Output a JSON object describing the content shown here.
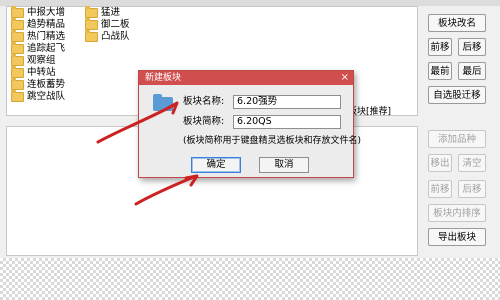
{
  "block_list": {
    "col1": [
      "中报大增",
      "趋势精品",
      "热门精选",
      "追踪起飞",
      "观察组",
      "中转站",
      "连板蓄势",
      "跳空战队"
    ],
    "col2": [
      "猛进",
      "御二板",
      "凸战队"
    ]
  },
  "save_header": "缓存板块[推荐]",
  "right_buttons": {
    "rename": "板块改名",
    "move_front": "前移",
    "move_back": "后移",
    "first": "最前",
    "last": "最后",
    "auto_move": "自选股迁移",
    "add_stock": "添加品种",
    "remove": "移出",
    "clear": "清空",
    "move_front2": "前移",
    "move_back2": "后移",
    "sort_in_block": "板块内排序",
    "export": "导出板块"
  },
  "dialog": {
    "title": "新建板块",
    "close": "×",
    "name_label": "板块名称:",
    "name_value": "6.20强势",
    "short_label": "板块简称:",
    "short_value": "6.20QS",
    "hint": "(板块简称用于键盘精灵选板块和存放文件名)",
    "ok": "确定",
    "cancel": "取消"
  },
  "annotation_color": "#cc2222",
  "title_bar_color": "#d04e4e"
}
